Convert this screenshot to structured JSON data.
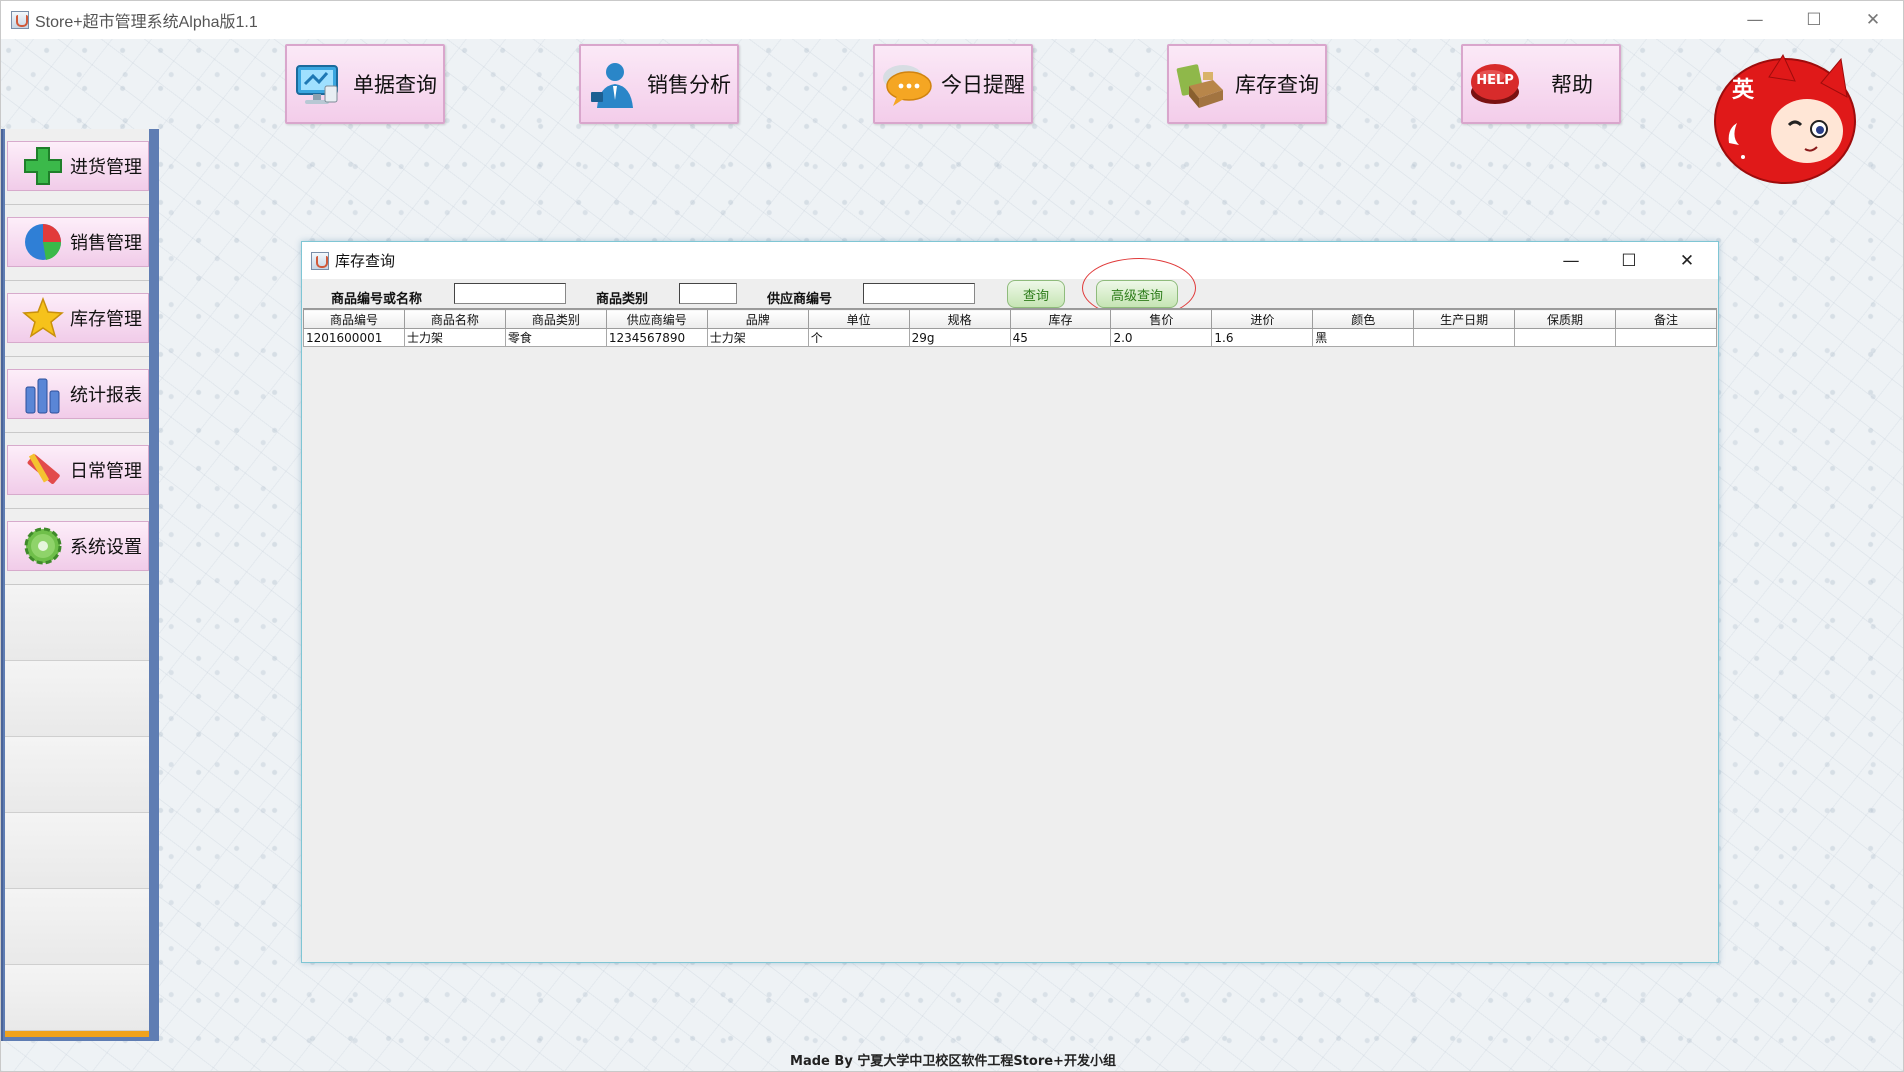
{
  "window": {
    "title": "Store+超市管理系统Alpha版1.1",
    "minimize": "—",
    "maximize": "☐",
    "close": "✕"
  },
  "toolbar": {
    "buttons": [
      {
        "label": "单据查询",
        "icon": "monitor-icon"
      },
      {
        "label": "销售分析",
        "icon": "businessman-icon"
      },
      {
        "label": "今日提醒",
        "icon": "chat-bubble-icon"
      },
      {
        "label": "库存查询",
        "icon": "inventory-box-icon"
      },
      {
        "label": "帮助",
        "icon": "help-button-icon",
        "icon_text": "HELP"
      }
    ]
  },
  "sidebar": {
    "items": [
      {
        "label": "进货管理",
        "icon": "plus-icon"
      },
      {
        "label": "销售管理",
        "icon": "pie-chart-icon"
      },
      {
        "label": "库存管理",
        "icon": "star-icon"
      },
      {
        "label": "统计报表",
        "icon": "bar-chart-icon"
      },
      {
        "label": "日常管理",
        "icon": "ruler-pencil-icon"
      },
      {
        "label": "系统设置",
        "icon": "gear-icon"
      }
    ]
  },
  "mascot": {
    "badge_text": "英"
  },
  "inventory_frame": {
    "title": "库存查询",
    "minimize": "—",
    "maximize": "☐",
    "close": "✕",
    "search": {
      "code_or_name_label": "商品编号或名称",
      "code_or_name_value": "",
      "category_label": "商品类别",
      "category_value": "",
      "supplier_label": "供应商编号",
      "supplier_value": "",
      "query_button": "查询",
      "advanced_query_button": "高级查询"
    },
    "table": {
      "columns": [
        "商品编号",
        "商品名称",
        "商品类别",
        "供应商编号",
        "品牌",
        "单位",
        "规格",
        "库存",
        "售价",
        "进价",
        "颜色",
        "生产日期",
        "保质期",
        "备注"
      ],
      "rows": [
        [
          "1201600001",
          "士力架",
          "零食",
          "1234567890",
          "士力架",
          "个",
          "29g",
          "45",
          "2.0",
          "1.6",
          "黑",
          "",
          "",
          ""
        ]
      ]
    }
  },
  "footer": {
    "text": "Made By 宁夏大学中卫校区软件工程Store+开发小组"
  }
}
